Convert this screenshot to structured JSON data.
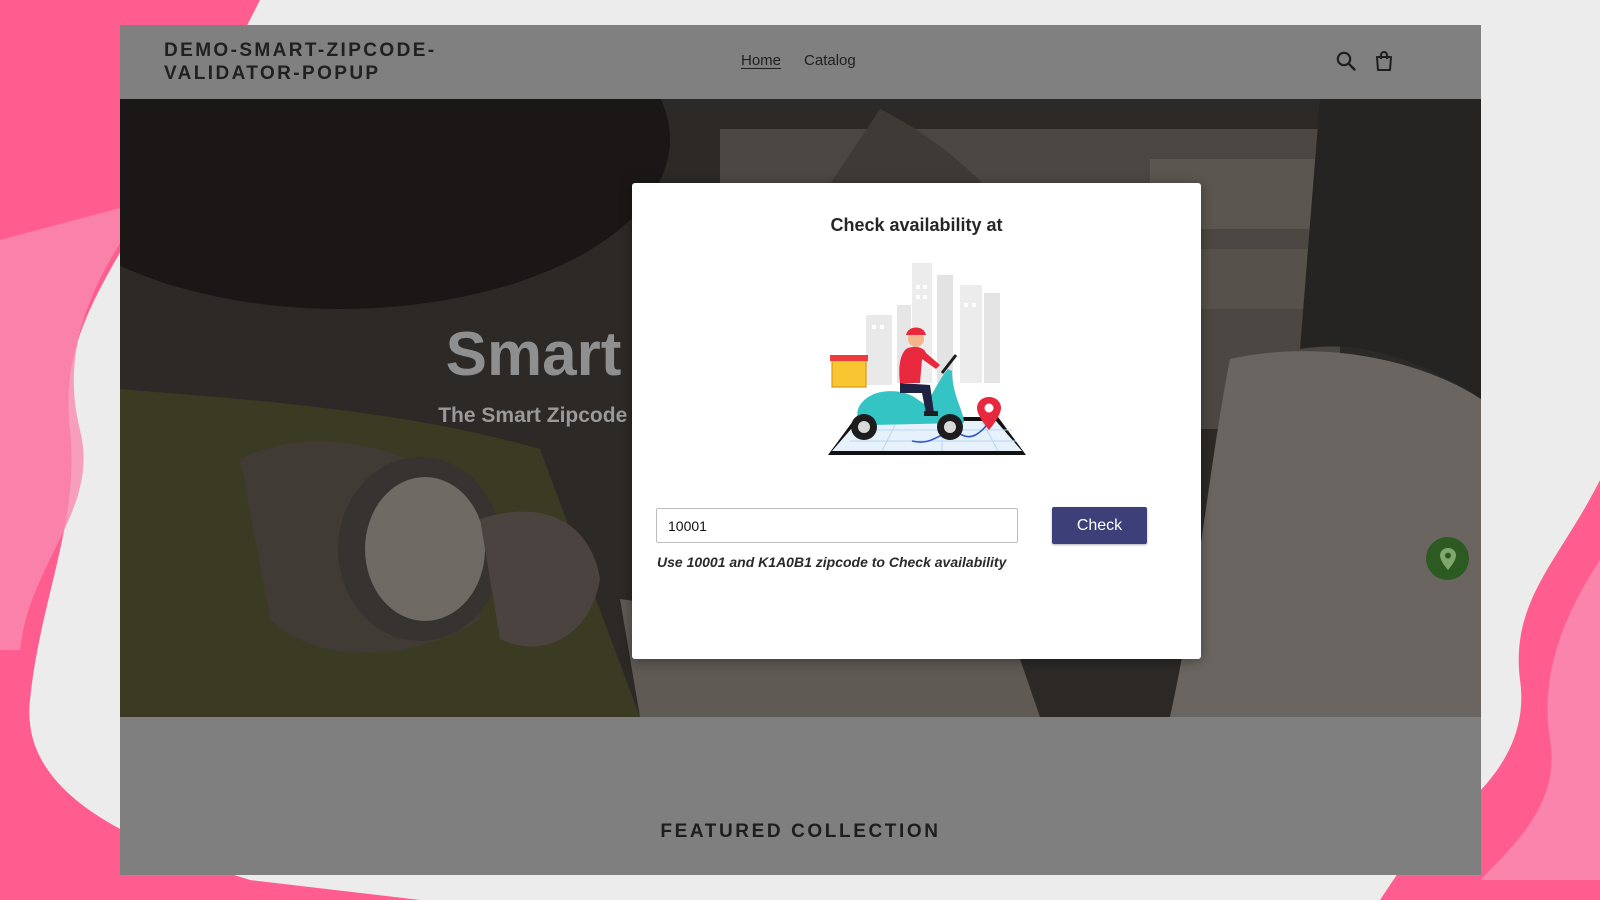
{
  "header": {
    "brand": "DEMO-SMART-ZIPCODE-VALIDATOR-POPUP",
    "nav": [
      {
        "label": "Home",
        "active": true
      },
      {
        "label": "Catalog",
        "active": false
      }
    ],
    "icons": [
      "search-icon",
      "cart-icon"
    ]
  },
  "hero": {
    "title": "Smart Zipcode Validator",
    "subtitle": "The Smart Zipcode Validator app helps you check the availability of your products by entering the zip"
  },
  "modal": {
    "title": "Check availability at",
    "input_value": "10001",
    "button_label": "Check",
    "hint": "Use 10001 and K1A0B1 zipcode to Check availability",
    "illustration": "delivery-scooter-illustration"
  },
  "featured": {
    "title": "FEATURED COLLECTION"
  },
  "floating": {
    "icon": "location-pin-icon"
  },
  "colors": {
    "accent": "#3c3f78",
    "backdrop_pink": "#ff5d8f",
    "overlay_gray": "#808080",
    "badge_green": "#2d5a20"
  }
}
